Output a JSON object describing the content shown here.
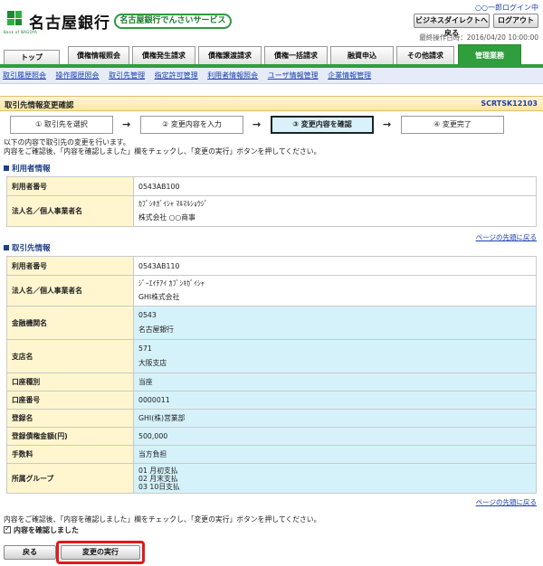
{
  "header": {
    "bank_name": "名古屋銀行",
    "logo_sub": "Bank of NAGOYA",
    "service_name": "名古屋銀行でんさいサービス",
    "user_login": "○○一郎ログイン中",
    "business_direct_button": "ビジネスダイレクトへ戻る",
    "logout_button": "ログアウト",
    "last_operation": "最終操作日時：2016/04/20 10:00:00"
  },
  "tabs": [
    {
      "label": "トップ"
    },
    {
      "label": "債権情報照会"
    },
    {
      "label": "債権発生請求"
    },
    {
      "label": "債権譲渡請求"
    },
    {
      "label": "債権一括請求"
    },
    {
      "label": "融資申込"
    },
    {
      "label": "その他請求"
    },
    {
      "label": "管理業務"
    }
  ],
  "submenu": [
    "取引履歴照会",
    "操作履歴照会",
    "取引先管理",
    "指定許可管理",
    "利用者情報照会",
    "ユーザ情報管理",
    "企業情報管理"
  ],
  "page": {
    "title": "取引先情報変更確認",
    "screen_code": "SCRTSK12103"
  },
  "steps": [
    "① 取引先を選択",
    "② 変更内容を入力",
    "③ 変更内容を確認",
    "④ 変更完了"
  ],
  "intro": {
    "line1": "以下の内容で取引先の変更を行います。",
    "line2": "内容をご確認後、「内容を確認しました」欄をチェックし、「変更の実行」ボタンを押してください。"
  },
  "user_info": {
    "heading": "利用者情報",
    "rows": {
      "user_no_label": "利用者番号",
      "user_no": "0543AB100",
      "name_label": "法人名／個人事業者名",
      "name_kana": "ｶﾌﾞｼｷｶﾞｲｼｬ ﾏﾙﾏﾙｼｮｳｼﾞ",
      "name": "株式会社 ○○商事"
    }
  },
  "partner_info": {
    "heading": "取引先情報",
    "rows": {
      "user_no_label": "利用者番号",
      "user_no": "0543AB110",
      "name_label": "法人名／個人事業者名",
      "name_kana": "ｼﾞｰｴｲﾁｱｲ ｶﾌﾞｼｷｶﾞｲｼｬ",
      "name": "GHI株式会社",
      "bank_label": "金融機関名",
      "bank_code": "0543",
      "bank_name": "名古屋銀行",
      "branch_label": "支店名",
      "branch_code": "571",
      "branch_name": "大阪支店",
      "account_type_label": "口座種別",
      "account_type": "当座",
      "account_no_label": "口座番号",
      "account_no": "0000011",
      "registered_name_label": "登録名",
      "registered_name": "GHI(株)営業部",
      "amount_label": "登録債権金額(円)",
      "amount": "500,000",
      "fee_label": "手数料",
      "fee": "当方負担",
      "group_label": "所属グループ",
      "group1": "01 月初支払",
      "group2": "02 月末支払",
      "group3": "03 10日支払"
    }
  },
  "top_link": "ページの先頭に戻る",
  "bottom": {
    "instruction": "内容をご確認後、「内容を確認しました」欄をチェックし、「変更の実行」ボタンを押してください。",
    "confirm_label": "内容を確認しました",
    "back_button": "戻る",
    "execute_button": "変更の実行"
  },
  "colors": {
    "brand_green": "#2f9e3c",
    "link_blue": "#1a3fb0",
    "highlight_red": "#e01a1a"
  }
}
